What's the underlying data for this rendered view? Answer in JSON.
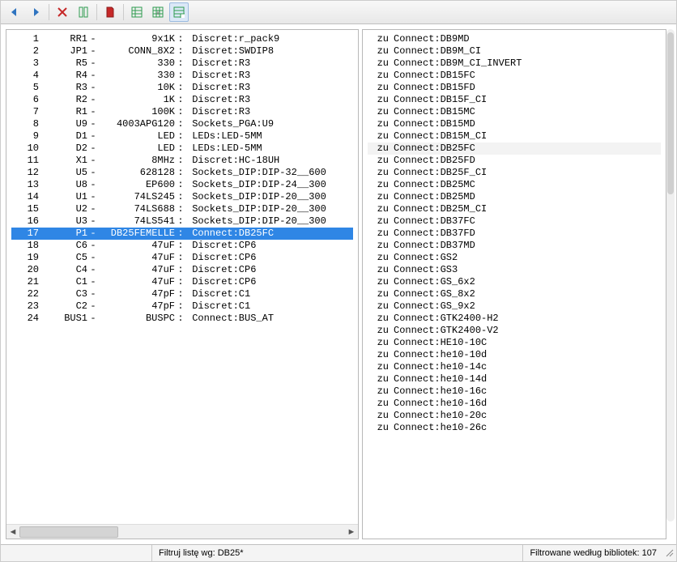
{
  "toolbar": {
    "icons": [
      "undo-icon",
      "redo-icon",
      "sep",
      "remove-x-icon",
      "column-icon",
      "sep",
      "pdf-icon",
      "sep",
      "grid-left-icon",
      "grid-hash-icon",
      "grid-list-icon"
    ]
  },
  "leftPane": {
    "rows": [
      {
        "n": "1",
        "ref": "RR1",
        "val": "9x1K",
        "fp": "Discret:r_pack9"
      },
      {
        "n": "2",
        "ref": "JP1",
        "val": "CONN_8X2",
        "fp": "Discret:SWDIP8"
      },
      {
        "n": "3",
        "ref": "R5",
        "val": "330",
        "fp": "Discret:R3"
      },
      {
        "n": "4",
        "ref": "R4",
        "val": "330",
        "fp": "Discret:R3"
      },
      {
        "n": "5",
        "ref": "R3",
        "val": "10K",
        "fp": "Discret:R3"
      },
      {
        "n": "6",
        "ref": "R2",
        "val": "1K",
        "fp": "Discret:R3"
      },
      {
        "n": "7",
        "ref": "R1",
        "val": "100K",
        "fp": "Discret:R3"
      },
      {
        "n": "8",
        "ref": "U9",
        "val": "4003APG120",
        "fp": "Sockets_PGA:U9"
      },
      {
        "n": "9",
        "ref": "D1",
        "val": "LED",
        "fp": "LEDs:LED-5MM"
      },
      {
        "n": "10",
        "ref": "D2",
        "val": "LED",
        "fp": "LEDs:LED-5MM"
      },
      {
        "n": "11",
        "ref": "X1",
        "val": "8MHz",
        "fp": "Discret:HC-18UH"
      },
      {
        "n": "12",
        "ref": "U5",
        "val": "628128",
        "fp": "Sockets_DIP:DIP-32__600"
      },
      {
        "n": "13",
        "ref": "U8",
        "val": "EP600",
        "fp": "Sockets_DIP:DIP-24__300"
      },
      {
        "n": "14",
        "ref": "U1",
        "val": "74LS245",
        "fp": "Sockets_DIP:DIP-20__300"
      },
      {
        "n": "15",
        "ref": "U2",
        "val": "74LS688",
        "fp": "Sockets_DIP:DIP-20__300"
      },
      {
        "n": "16",
        "ref": "U3",
        "val": "74LS541",
        "fp": "Sockets_DIP:DIP-20__300"
      },
      {
        "n": "17",
        "ref": "P1",
        "val": "DB25FEMELLE",
        "fp": "Connect:DB25FC",
        "sel": true
      },
      {
        "n": "18",
        "ref": "C6",
        "val": "47uF",
        "fp": "Discret:CP6"
      },
      {
        "n": "19",
        "ref": "C5",
        "val": "47uF",
        "fp": "Discret:CP6"
      },
      {
        "n": "20",
        "ref": "C4",
        "val": "47uF",
        "fp": "Discret:CP6"
      },
      {
        "n": "21",
        "ref": "C1",
        "val": "47uF",
        "fp": "Discret:CP6"
      },
      {
        "n": "22",
        "ref": "C3",
        "val": "47pF",
        "fp": "Discret:C1"
      },
      {
        "n": "23",
        "ref": "C2",
        "val": "47pF",
        "fp": "Discret:C1"
      },
      {
        "n": "24",
        "ref": "BUS1",
        "val": "BUSPC",
        "fp": "Connect:BUS_AT"
      }
    ]
  },
  "rightPane": {
    "prefix": "zu",
    "rows": [
      {
        "t": "Connect:DB9MD"
      },
      {
        "t": "Connect:DB9M_CI"
      },
      {
        "t": "Connect:DB9M_CI_INVERT"
      },
      {
        "t": "Connect:DB15FC"
      },
      {
        "t": "Connect:DB15FD"
      },
      {
        "t": "Connect:DB15F_CI"
      },
      {
        "t": "Connect:DB15MC"
      },
      {
        "t": "Connect:DB15MD"
      },
      {
        "t": "Connect:DB15M_CI"
      },
      {
        "t": "Connect:DB25FC",
        "hl": true
      },
      {
        "t": "Connect:DB25FD"
      },
      {
        "t": "Connect:DB25F_CI"
      },
      {
        "t": "Connect:DB25MC"
      },
      {
        "t": "Connect:DB25MD"
      },
      {
        "t": "Connect:DB25M_CI"
      },
      {
        "t": "Connect:DB37FC"
      },
      {
        "t": "Connect:DB37FD"
      },
      {
        "t": "Connect:DB37MD"
      },
      {
        "t": "Connect:GS2"
      },
      {
        "t": "Connect:GS3"
      },
      {
        "t": "Connect:GS_6x2"
      },
      {
        "t": "Connect:GS_8x2"
      },
      {
        "t": "Connect:GS_9x2"
      },
      {
        "t": "Connect:GTK2400-H2"
      },
      {
        "t": "Connect:GTK2400-V2"
      },
      {
        "t": "Connect:HE10-10C"
      },
      {
        "t": "Connect:he10-10d"
      },
      {
        "t": "Connect:he10-14c"
      },
      {
        "t": "Connect:he10-14d"
      },
      {
        "t": "Connect:he10-16c"
      },
      {
        "t": "Connect:he10-16d"
      },
      {
        "t": "Connect:he10-20c"
      },
      {
        "t": "Connect:he10-26c"
      }
    ]
  },
  "status": {
    "filter_label": "Filtruj listę wg: DB25*",
    "lib_label": "Filtrowane według bibliotek: 107"
  }
}
